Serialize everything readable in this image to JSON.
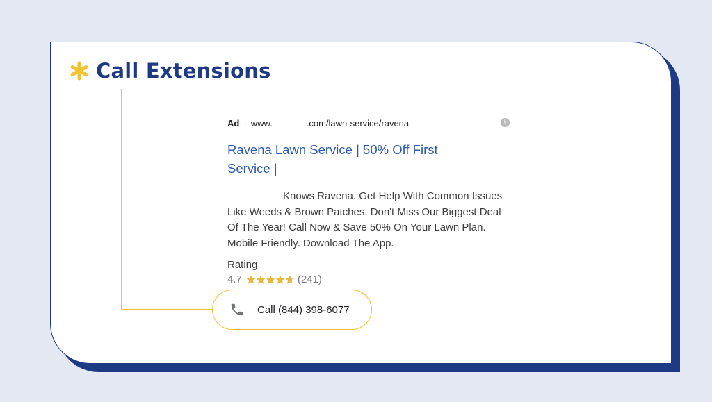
{
  "header": {
    "icon": "asterisk-icon",
    "title": "Call Extensions",
    "accent_color": "#f2c230",
    "brand_color": "#1f3a84"
  },
  "ad": {
    "label": "Ad",
    "separator": "·",
    "url_prefix": "www.",
    "url_path": ".com/lawn-service/ravena",
    "info_icon": "info-icon",
    "headline": "Ravena Lawn Service | 50% Off First Service |",
    "description": "Knows Ravena. Get Help With Common Issues Like Weeds & Brown Patches. Don't Miss Our Biggest Deal Of The Year! Call Now & Save 50% On Your Lawn Plan. Mobile Friendly. Download The App.",
    "rating_label": "Rating",
    "rating_value": "4.7",
    "rating_stars": 4.7,
    "rating_count": "(241)"
  },
  "call": {
    "icon": "phone-icon",
    "label": "Call (844) 398-6077"
  }
}
